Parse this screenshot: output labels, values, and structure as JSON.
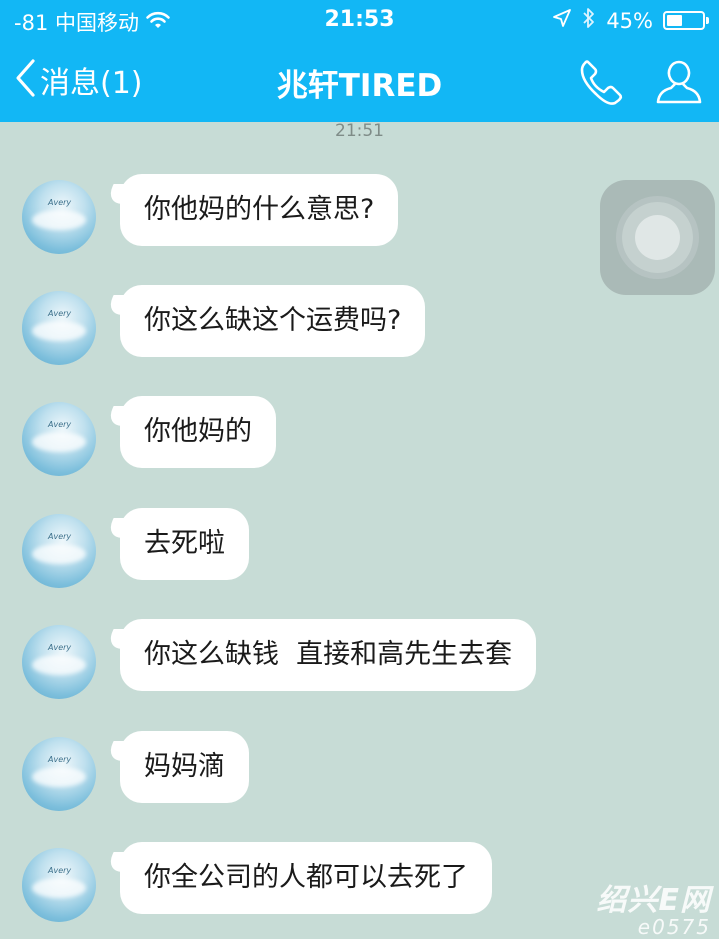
{
  "status_bar": {
    "carrier": "-81 中国移动",
    "time": "21:53",
    "battery_text": "45%",
    "battery_level": 0.45,
    "icons": [
      "wifi-icon",
      "location-arrow-icon",
      "bluetooth-icon",
      "battery-icon"
    ]
  },
  "nav": {
    "back_label": "消息(1)",
    "title": "兆轩TIRED",
    "icons": [
      "chevron-left-icon",
      "phone-icon",
      "profile-icon"
    ]
  },
  "chat": {
    "timestamp": "21:51",
    "avatar_text": "Avery",
    "messages": [
      {
        "text": "你他妈的什么意思?"
      },
      {
        "text": "你这么缺这个运费吗?"
      },
      {
        "text": "你他妈的"
      },
      {
        "text": "去死啦"
      },
      {
        "text": "你这么缺钱  直接和高先生去套"
      },
      {
        "text": "妈妈滴"
      },
      {
        "text": "你全公司的人都可以去死了"
      }
    ]
  },
  "watermark": {
    "main": "绍兴E网",
    "sub": "e0575"
  },
  "colors": {
    "header": "#12b7f5",
    "chat_background": "#c7dcd6",
    "bubble": "#ffffff"
  }
}
